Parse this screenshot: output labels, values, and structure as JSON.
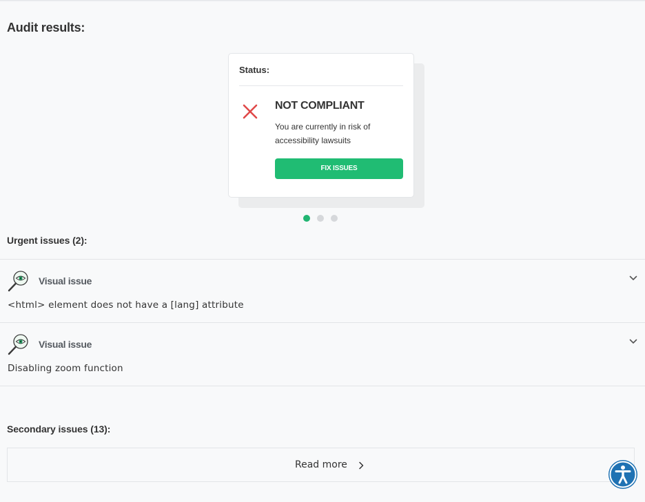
{
  "page": {
    "title": "Audit results:"
  },
  "status_card": {
    "label": "Status:",
    "heading": "NOT COMPLIANT",
    "description": "You are currently in risk of accessibility lawsuits",
    "button_label": "FIX ISSUES",
    "icon": "close-x-icon",
    "colors": {
      "error": "#e04848",
      "button": "#20bc73"
    }
  },
  "carousel": {
    "slide_count": 3,
    "active_slide": 1,
    "active_color": "#21b572"
  },
  "urgent": {
    "title": "Urgent issues (2):",
    "items": [
      {
        "type": "Visual issue",
        "icon": "magnifier-eye-icon",
        "text": "<html> element does not have a [lang] attribute"
      },
      {
        "type": "Visual issue",
        "icon": "magnifier-eye-icon",
        "text": "Disabling zoom function"
      }
    ]
  },
  "secondary": {
    "title": "Secondary issues (13):",
    "read_more": "Read more"
  },
  "accessibility_widget": {
    "icon": "accessibility-icon",
    "color": "#1f72b3"
  }
}
